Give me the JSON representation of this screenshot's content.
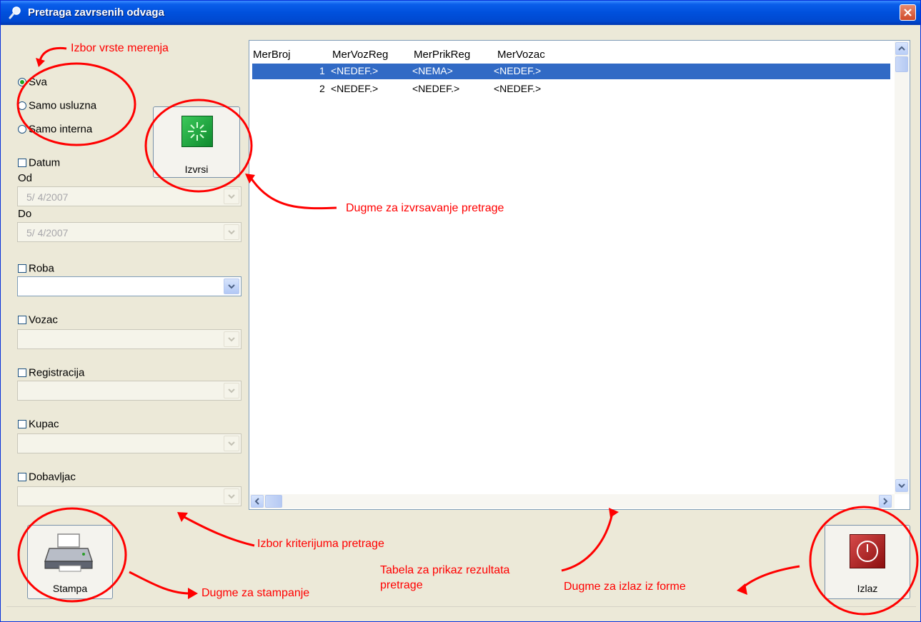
{
  "window": {
    "title": "Pretraga zavrsenih odvaga",
    "close_icon": "close-icon"
  },
  "measurement_type": {
    "options": [
      {
        "label": "Sva",
        "selected": true
      },
      {
        "label": "Samo usluzna",
        "selected": false
      },
      {
        "label": "Samo interna",
        "selected": false
      }
    ]
  },
  "filters": {
    "datum": {
      "label": "Datum",
      "od_label": "Od",
      "od_value": "5/ 4/2007",
      "do_label": "Do",
      "do_value": "5/ 4/2007"
    },
    "roba": {
      "label": "Roba",
      "value": ""
    },
    "vozac": {
      "label": "Vozac",
      "value": ""
    },
    "registracija": {
      "label": "Registracija",
      "value": ""
    },
    "kupac": {
      "label": "Kupac",
      "value": ""
    },
    "dobavljac": {
      "label": "Dobavljac",
      "value": ""
    }
  },
  "buttons": {
    "izvrsi": "Izvrsi",
    "stampa": "Stampa",
    "izlaz": "Izlaz"
  },
  "table": {
    "columns": [
      "MerBroj",
      "MerVozReg",
      "MerPrikReg",
      "MerVozac"
    ],
    "rows": [
      {
        "broj": "1",
        "vozreg": "<NEDEF.>",
        "prikreg": "<NEMA>",
        "vozac": "<NEDEF.>",
        "selected": true
      },
      {
        "broj": "2",
        "vozreg": "<NEDEF.>",
        "prikreg": "<NEDEF.>",
        "vozac": "<NEDEF.>",
        "selected": false
      }
    ]
  },
  "annotations": {
    "izbor_vrste": "Izbor vrste merenja",
    "izvrsavanje": "Dugme za izvrsavanje pretrage",
    "kriterijum": "Izbor kriterijuma pretrage",
    "tabela_1": "Tabela za prikaz rezultata",
    "tabela_2": "pretrage",
    "stampanje": "Dugme za stampanje",
    "izlaz": "Dugme za izlaz iz forme"
  },
  "colors": {
    "title_bar": "#0050DC",
    "selection": "#316AC5",
    "annotation": "#FF0000",
    "window_bg": "#ECE9D8"
  }
}
